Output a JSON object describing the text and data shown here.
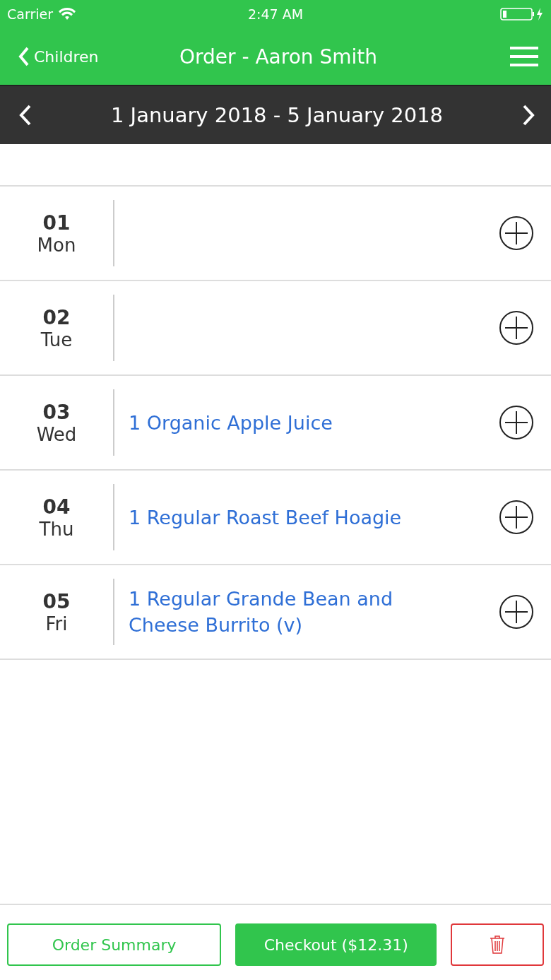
{
  "status_bar": {
    "carrier": "Carrier",
    "time": "2:47 AM"
  },
  "nav": {
    "back": "Children",
    "title": "Order - Aaron Smith"
  },
  "week": {
    "label": "1 January 2018 - 5 January 2018"
  },
  "days": [
    {
      "day": "01",
      "weekday": "Mon"
    },
    {
      "day": "02",
      "weekday": "Tue"
    },
    {
      "day": "03",
      "weekday": "Wed",
      "items": [
        "1 Organic Apple Juice"
      ]
    },
    {
      "day": "04",
      "weekday": "Thu",
      "items": [
        "1 Regular Roast Beef Hoagie"
      ]
    },
    {
      "day": "05",
      "weekday": "Fri",
      "items": [
        "1 Regular Grande Bean and Cheese Burrito (v)"
      ]
    }
  ],
  "footer": {
    "summary": "Order Summary",
    "checkout": "Checkout ($12.31)"
  }
}
